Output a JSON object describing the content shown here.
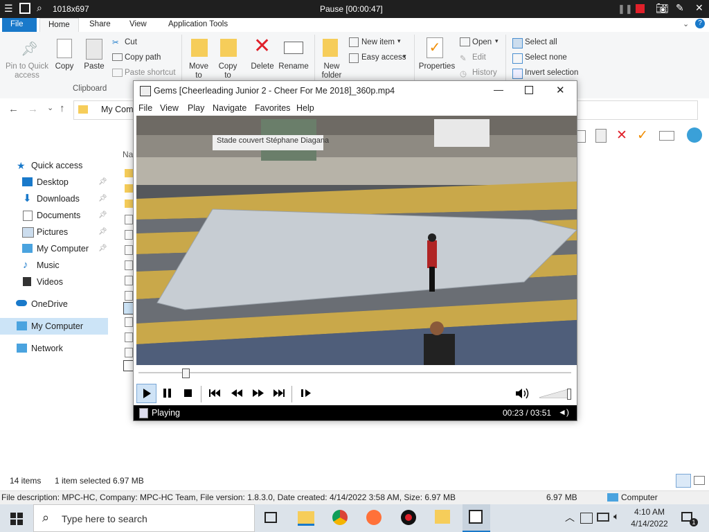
{
  "remote_bar": {
    "resolution": "1018x697",
    "session_status": "Pause [00:00:47]"
  },
  "explorer": {
    "tabs": [
      "File",
      "Home",
      "Share",
      "View",
      "Application Tools"
    ],
    "ribbon": {
      "clipboard": {
        "pin_label": "Pin to Quick access",
        "copy": "Copy",
        "paste": "Paste",
        "cut": "Cut",
        "copy_path": "Copy path",
        "paste_shortcut": "Paste shortcut",
        "group": "Clipboard"
      },
      "organize": {
        "move_to": "Move to",
        "copy_to": "Copy to",
        "delete": "Delete",
        "rename": "Rename"
      },
      "new": {
        "new_folder": "New folder",
        "new_item": "New item",
        "easy_access": "Easy access"
      },
      "open": {
        "properties": "Properties",
        "open": "Open",
        "edit": "Edit",
        "history": "History"
      },
      "select": {
        "select_all": "Select all",
        "select_none": "Select none",
        "invert": "Invert selection"
      }
    },
    "address_partial": "My Com",
    "column_header_partial": "Na",
    "sidebar": [
      {
        "label": "Quick access",
        "icon": "star-icon",
        "pinned": false
      },
      {
        "label": "Desktop",
        "icon": "desktop-icon",
        "pinned": true
      },
      {
        "label": "Downloads",
        "icon": "download-icon",
        "pinned": true
      },
      {
        "label": "Documents",
        "icon": "documents-icon",
        "pinned": true
      },
      {
        "label": "Pictures",
        "icon": "pictures-icon",
        "pinned": true
      },
      {
        "label": "My Computer",
        "icon": "computer-icon",
        "pinned": true
      },
      {
        "label": "Music",
        "icon": "music-icon",
        "pinned": false
      },
      {
        "label": "Videos",
        "icon": "videos-icon",
        "pinned": false
      },
      {
        "label": "OneDrive",
        "icon": "cloud-icon",
        "pinned": false
      },
      {
        "label": "My Computer",
        "icon": "computer-icon",
        "pinned": false
      },
      {
        "label": "Network",
        "icon": "network-icon",
        "pinned": false
      }
    ],
    "status": {
      "items": "14 items",
      "selected": "1 item selected  6.97 MB"
    },
    "description_bar": {
      "text": "File description: MPC-HC, Company: MPC-HC Team, File version: 1.8.3.0, Date created: 4/14/2022 3:58 AM, Size: 6.97 MB",
      "size": "6.97 MB",
      "location": "Computer"
    }
  },
  "mpc": {
    "title": "Gems  [Cheerleading Junior 2 - Cheer For Me 2018]_360p.mp4",
    "menu": [
      "File",
      "View",
      "Play",
      "Navigate",
      "Favorites",
      "Help"
    ],
    "video_sign": "Stade couvert Stéphane Diagana",
    "seek_position": 0.1,
    "volume_level": 0.95,
    "status_text": "Playing",
    "time": "00:23 / 03:51"
  },
  "taskbar": {
    "search_placeholder": "Type here to search",
    "time": "4:10 AM",
    "date": "4/14/2022",
    "notification_count": "1"
  },
  "colors": {
    "accent": "#1979ca",
    "ribbon_bg": "#f5f6f7",
    "taskbar": "#dce3ea",
    "selected_nav": "#cce4f7"
  }
}
